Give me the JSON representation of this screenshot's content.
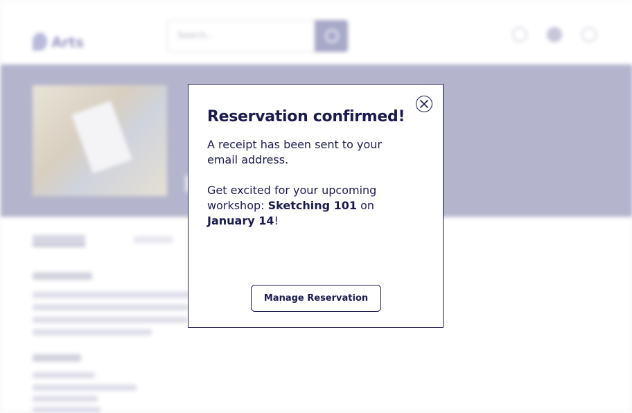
{
  "header": {
    "logo_text": "Arts",
    "search": {
      "placeholder": "Search..."
    },
    "icons": [
      "search-icon",
      "user-icon",
      "account-icon",
      "cart-icon"
    ]
  },
  "modal": {
    "title": "Reservation confirmed!",
    "receipt_text": "A receipt has been sent to your email address.",
    "excited_prefix": "Get excited for your upcoming workshop: ",
    "workshop_name": "Sketching 101",
    "on_word": " on",
    "date": "January 14",
    "exclamation": "!",
    "close_icon": "close-icon",
    "manage_button_label": "Manage Reservation"
  },
  "colors": {
    "primary": "#1b1a4f",
    "hero_bg": "#b4b4cc",
    "modal_bg": "#ffffff"
  }
}
